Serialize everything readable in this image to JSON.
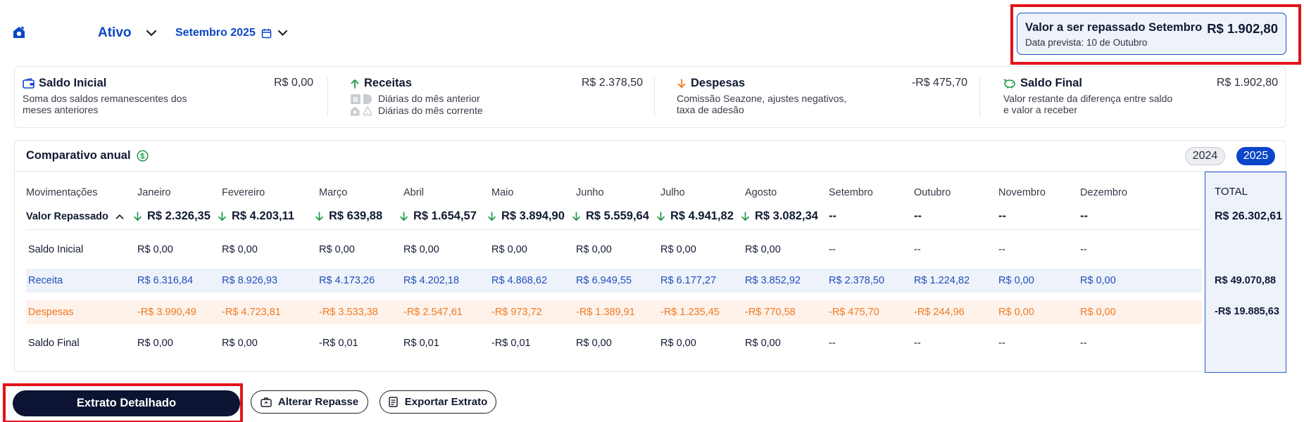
{
  "header": {
    "status_label": "Ativo",
    "month_label": "Setembro 2025",
    "repasse": {
      "title": "Valor a ser repassado Setembro",
      "amount": "R$ 1.902,80",
      "subtitle": "Data prevista: 10 de Outubro"
    }
  },
  "summary": {
    "saldo_inicial": {
      "title": "Saldo Inicial",
      "value": "R$ 0,00",
      "desc_line1": "Soma dos saldos remanescentes dos",
      "desc_line2": "meses anteriores"
    },
    "receitas": {
      "title": "Receitas",
      "value": "R$ 2.378,50",
      "line1": "Diárias do mês anterior",
      "line2": "Diárias do mês corrente"
    },
    "despesas": {
      "title": "Despesas",
      "value": "-R$ 475,70",
      "desc_line1": "Comissão Seazone, ajustes negativos,",
      "desc_line2": "taxa de adesão"
    },
    "saldo_final": {
      "title": "Saldo Final",
      "value": "R$ 1.902,80",
      "desc_line1": "Valor restante da diferença entre saldo",
      "desc_line2": "e valor a receber"
    }
  },
  "comparativo": {
    "title": "Comparativo anual",
    "years": [
      "2024",
      "2025"
    ],
    "selected_year": "2025",
    "header_label": "Movimentações",
    "months": [
      "Janeiro",
      "Fevereiro",
      "Março",
      "Abril",
      "Maio",
      "Junho",
      "Julho",
      "Agosto",
      "Setembro",
      "Outubro",
      "Novembro",
      "Dezembro"
    ],
    "valor_repassado_label": "Valor Repassado",
    "valor_repassado": [
      "R$ 2.326,35",
      "R$ 4.203,11",
      "R$ 639,88",
      "R$ 1.654,57",
      "R$ 3.894,90",
      "R$ 5.559,64",
      "R$ 4.941,82",
      "R$ 3.082,34",
      "--",
      "--",
      "--",
      "--"
    ],
    "rows": {
      "saldo_inicial": {
        "label": "Saldo Inicial",
        "values": [
          "R$ 0,00",
          "R$ 0,00",
          "R$ 0,00",
          "R$ 0,00",
          "R$ 0,00",
          "R$ 0,00",
          "R$ 0,00",
          "R$ 0,00",
          "--",
          "--",
          "--",
          "--"
        ]
      },
      "receita": {
        "label": "Receita",
        "values": [
          "R$ 6.316,84",
          "R$ 8.926,93",
          "R$ 4.173,26",
          "R$ 4.202,18",
          "R$ 4.868,62",
          "R$ 6.949,55",
          "R$ 6.177,27",
          "R$ 3.852,92",
          "R$ 2.378,50",
          "R$ 1.224,82",
          "R$ 0,00",
          "R$ 0,00"
        ]
      },
      "despesas": {
        "label": "Despesas",
        "values": [
          "-R$ 3.990,49",
          "-R$ 4.723,81",
          "-R$ 3.533,38",
          "-R$ 2.547,61",
          "-R$ 973,72",
          "-R$ 1.389,91",
          "-R$ 1.235,45",
          "-R$ 770,58",
          "-R$ 475,70",
          "-R$ 244,96",
          "R$ 0,00",
          "R$ 0,00"
        ]
      },
      "saldo_final": {
        "label": "Saldo Final",
        "values": [
          "R$ 0,00",
          "R$ 0,00",
          "-R$ 0,01",
          "R$ 0,01",
          "-R$ 0,01",
          "R$ 0,00",
          "R$ 0,00",
          "R$ 0,00",
          "--",
          "--",
          "--",
          "--"
        ]
      }
    },
    "total": {
      "label": "TOTAL",
      "valor_repassado": "R$ 26.302,61",
      "receita": "R$ 49.070,88",
      "despesas": "-R$ 19.885,63"
    }
  },
  "actions": {
    "extrato_label": "Extrato Detalhado",
    "alterar_label": "Alterar Repasse",
    "exportar_label": "Exportar Extrato"
  },
  "colors": {
    "brand_blue": "#0b46c8",
    "dark_navy": "#0d1433",
    "receita_blue": "#1f4fb8",
    "despesa_orange": "#ef7a24",
    "up_green": "#1d9a4a",
    "highlight_red": "#e3131b"
  }
}
